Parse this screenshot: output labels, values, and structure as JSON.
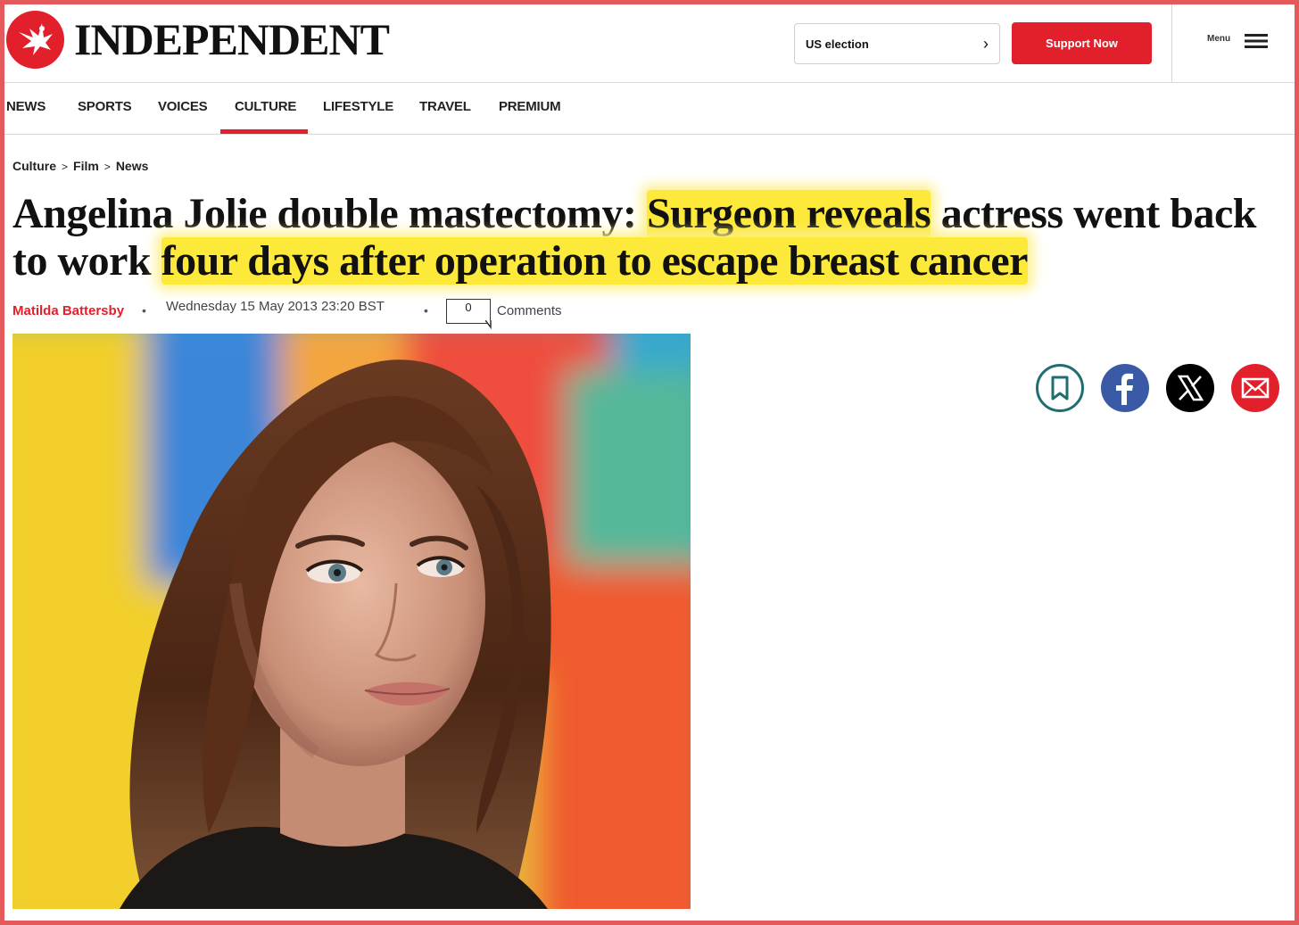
{
  "brand": {
    "name": "INDEPENDENT",
    "accent": "#e2202c"
  },
  "header": {
    "election_label": "US election",
    "support_label": "Support Now",
    "menu_label": "Menu"
  },
  "nav": {
    "items": [
      "NEWS",
      "SPORTS",
      "VOICES",
      "CULTURE",
      "LIFESTYLE",
      "TRAVEL",
      "PREMIUM"
    ],
    "active": "CULTURE"
  },
  "breadcrumb": {
    "items": [
      "Culture",
      "Film",
      "News"
    ],
    "separator": ">"
  },
  "article": {
    "headline_part1": "Angelina Jolie double mastectomy: ",
    "headline_hl1": "Surgeon reveals",
    "headline_part2": " actress went back to work ",
    "headline_hl2": "four days after operation to escape breast cancer",
    "highlight_color": "#fde93a",
    "author": "Matilda Battersby",
    "date": "Wednesday 15 May 2013 23:20 BST",
    "comment_count": "0",
    "comments_label": "Comments"
  },
  "share": {
    "icons": [
      "bookmark-icon",
      "facebook-icon",
      "x-icon",
      "email-icon"
    ],
    "colors": {
      "bookmark": "#1f6f72",
      "facebook": "#3b5aa5",
      "x": "#000000",
      "email": "#e2202c"
    }
  }
}
